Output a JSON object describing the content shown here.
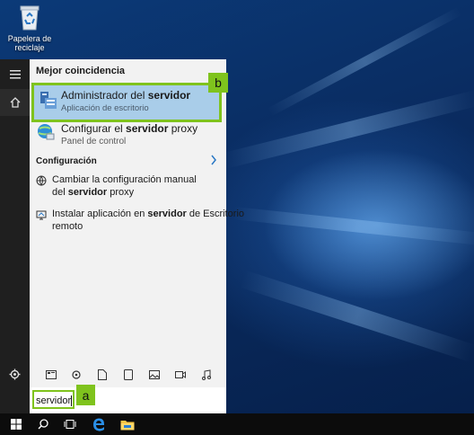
{
  "desktop": {
    "recycle_bin": {
      "label_line1": "Papelera de",
      "label_line2": "reciclaje",
      "icon": "recycle-bin-icon"
    }
  },
  "start_rail": {
    "menu_icon": "hamburger-icon",
    "home_icon": "home-icon",
    "settings_icon": "gear-icon"
  },
  "results": {
    "best_match_header": "Mejor coincidencia",
    "best_match": {
      "title_plain": "Administrador del ",
      "title_bold": "servidor",
      "subtitle": "Aplicación de escritorio",
      "icon": "server-manager-icon"
    },
    "second": {
      "title_plain": "Configurar el ",
      "title_bold": "servidor",
      "title_tail": " proxy",
      "subtitle": "Panel de control",
      "icon": "globe-network-icon"
    },
    "settings_header": "Configuración",
    "settings_items": [
      {
        "line1": "Cambiar la configuración manual",
        "line2_plain": "del ",
        "line2_bold": "servidor",
        "line2_tail": " proxy",
        "icon": "globe-icon"
      },
      {
        "line1_plain": "Instalar aplicación en ",
        "line1_bold": "servidor",
        "line1_tail": " de Escritorio",
        "line2": "remoto",
        "icon": "remote-desktop-icon"
      }
    ]
  },
  "filter_icons": [
    "apps-icon",
    "settings-icon",
    "document-icon",
    "tablet-icon",
    "photo-icon",
    "video-icon",
    "music-icon"
  ],
  "search": {
    "value": "servidor"
  },
  "badges": {
    "a": "a",
    "b": "b"
  },
  "colors": {
    "highlight": "#7fc31d",
    "selected": "#a9cde9",
    "panel": "#f2f2f2",
    "rail": "#1f1f1f",
    "taskbar": "#0c0c0c"
  },
  "taskbar": [
    "windows-start-icon",
    "search-icon",
    "task-view-icon",
    "edge-icon",
    "file-explorer-icon"
  ]
}
